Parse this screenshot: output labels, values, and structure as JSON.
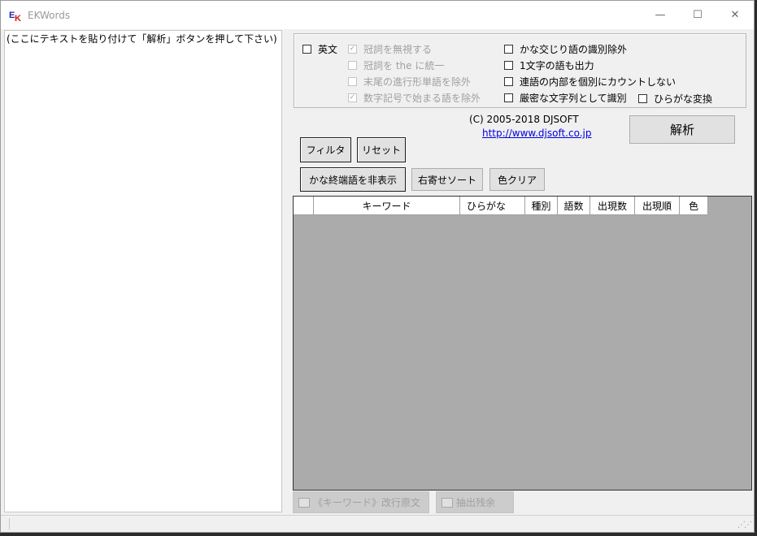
{
  "window": {
    "title": "EKWords",
    "icon": "ek-app-icon",
    "controls": {
      "minimize": "—",
      "maximize": "☐",
      "close": "✕"
    }
  },
  "text_input": {
    "placeholder_text": "(ここにテキストを貼り付けて「解析」ボタンを押して下さい)"
  },
  "options": {
    "col1": [
      {
        "label": "英文",
        "checked": false,
        "enabled": true
      }
    ],
    "col2": [
      {
        "label": "冠詞を無視する",
        "checked": true,
        "enabled": false
      },
      {
        "label": "冠詞を the に統一",
        "checked": false,
        "enabled": false
      },
      {
        "label": "末尾の進行形単語を除外",
        "checked": false,
        "enabled": false
      },
      {
        "label": "数字記号で始まる語を除外",
        "checked": true,
        "enabled": false
      }
    ],
    "col3": [
      {
        "label": "かな交じり語の識別除外",
        "checked": false,
        "enabled": true
      },
      {
        "label": "1文字の語も出力",
        "checked": false,
        "enabled": true
      },
      {
        "label": "連語の内部を個別にカウントしない",
        "checked": false,
        "enabled": true
      },
      {
        "label": "厳密な文字列として識別",
        "checked": false,
        "enabled": true
      }
    ],
    "hiragana": {
      "label": "ひらがな変換",
      "checked": false,
      "enabled": true
    }
  },
  "copyright": "(C) 2005-2018 DJSOFT",
  "url": "http://www.djsoft.co.jp",
  "buttons": {
    "analyze": "解析",
    "filter": "フィルタ",
    "reset": "リセット",
    "hide_kana": "かな終端語を非表示",
    "right_sort": "右寄せソート",
    "color_clear": "色クリア"
  },
  "grid": {
    "columns": [
      "",
      "キーワード",
      "ひらがな",
      "種別",
      "語数",
      "出現数",
      "出現順",
      "色"
    ],
    "rows": []
  },
  "toggles": {
    "keyword_newline": "《キーワード》改行原文",
    "extract_remaining": "抽出残余"
  },
  "colors": {
    "grid_background": "#ababab",
    "link": "#0000dd",
    "disabled_text": "#a0a0a0"
  }
}
